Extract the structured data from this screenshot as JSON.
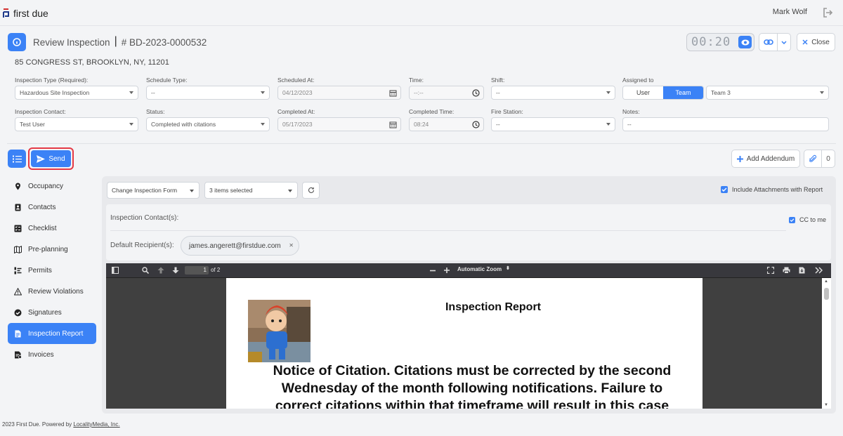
{
  "app": {
    "logo_text": "first due",
    "user_name": "Mark Wolf"
  },
  "header": {
    "title": "Review Inspection",
    "record_id": "# BD-2023-0000532",
    "address": "85 CONGRESS ST, BROOKLYN, NY, 11201",
    "timer": "00:20",
    "close_label": "Close"
  },
  "form": {
    "inspection_type": {
      "label": "Inspection Type (Required):",
      "value": "Hazardous Site Inspection"
    },
    "schedule_type": {
      "label": "Schedule Type:",
      "value": "--"
    },
    "scheduled_at": {
      "label": "Scheduled At:",
      "value": "04/12/2023"
    },
    "time": {
      "label": "Time:",
      "value": "--:--"
    },
    "shift": {
      "label": "Shift:",
      "value": "--"
    },
    "assigned_to": {
      "label": "Assigned to",
      "options": [
        "User",
        "Team"
      ],
      "selected": "Team",
      "team_value": "Team 3"
    },
    "inspection_contact": {
      "label": "Inspection Contact:",
      "value": "Test User"
    },
    "status": {
      "label": "Status:",
      "value": "Completed with citations"
    },
    "completed_at": {
      "label": "Completed At:",
      "value": "05/17/2023"
    },
    "completed_time": {
      "label": "Completed Time:",
      "value": "08:24"
    },
    "fire_station": {
      "label": "Fire Station:",
      "value": "--"
    },
    "notes": {
      "label": "Notes:",
      "value": "--"
    }
  },
  "actions": {
    "send_label": "Send",
    "addendum_label": "Add Addendum",
    "attachments_count": "0"
  },
  "nav": [
    {
      "label": "Occupancy",
      "icon": "map-pin-icon"
    },
    {
      "label": "Contacts",
      "icon": "contact-card-icon"
    },
    {
      "label": "Checklist",
      "icon": "checklist-icon"
    },
    {
      "label": "Pre-planning",
      "icon": "map-icon"
    },
    {
      "label": "Permits",
      "icon": "permits-list-icon"
    },
    {
      "label": "Review Violations",
      "icon": "warning-icon"
    },
    {
      "label": "Signatures",
      "icon": "check-circle-icon"
    },
    {
      "label": "Inspection Report",
      "icon": "document-icon",
      "active": true
    },
    {
      "label": "Invoices",
      "icon": "invoice-icon"
    }
  ],
  "report": {
    "form_select": "Change Inspection Form",
    "items_select": "3 items selected",
    "include_attachments": "Include Attachments with Report",
    "contacts_label": "Inspection Contact(s):",
    "cc_label": "CC to me",
    "recipients_label": "Default Recipient(s):",
    "recipient_email": "james.angerett@firstdue.com"
  },
  "pdf": {
    "page_number": "1",
    "page_total": "of 2",
    "zoom": "Automatic Zoom",
    "title": "Inspection Report",
    "notice_line1": "Notice of Citation. Citations must be corrected by the second",
    "notice_line2": "Wednesday of the month following notifications. Failure to",
    "notice_line3": "correct citations within that timeframe will result in this case"
  },
  "footer": {
    "text": "2023 First Due. Powered by ",
    "link": "LocalityMedia, Inc."
  },
  "colors": {
    "primary": "#3b82f6",
    "highlight": "#e53945"
  }
}
